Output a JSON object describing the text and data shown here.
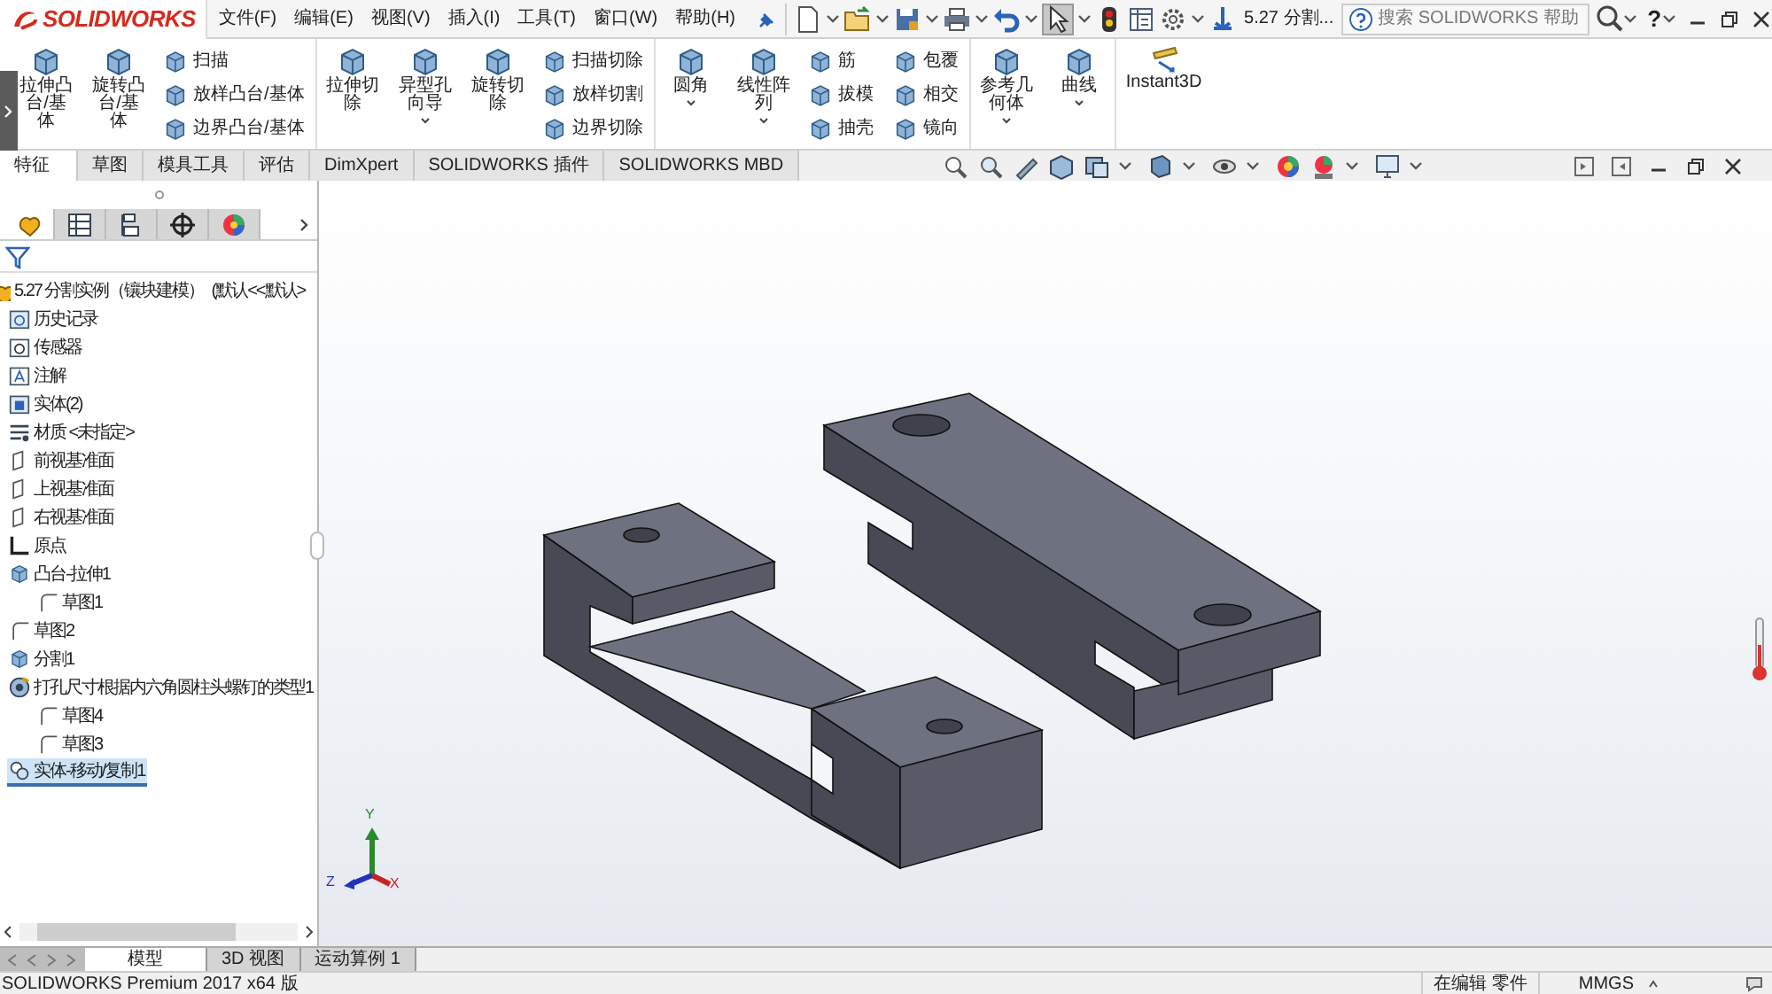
{
  "app": {
    "logo": "SOLIDWORKS",
    "document_title": "5.27 分割...",
    "help": "?"
  },
  "menu": [
    "文件(F)",
    "编辑(E)",
    "视图(V)",
    "插入(I)",
    "工具(T)",
    "窗口(W)",
    "帮助(H)"
  ],
  "search": {
    "placeholder": "搜索 SOLIDWORKS 帮助"
  },
  "ribbon": [
    {
      "columns": [
        {
          "kind": "large",
          "items": [
            {
              "label": "拉伸凸台/基体",
              "dropdown": false
            }
          ]
        },
        {
          "kind": "large",
          "items": [
            {
              "label": "旋转凸台/基体",
              "dropdown": false
            }
          ]
        },
        {
          "kind": "stack",
          "items": [
            {
              "label": "扫描"
            },
            {
              "label": "放样凸台/基体"
            },
            {
              "label": "边界凸台/基体"
            }
          ]
        }
      ]
    },
    {
      "columns": [
        {
          "kind": "large",
          "items": [
            {
              "label": "拉伸切除",
              "dropdown": false
            }
          ]
        },
        {
          "kind": "large",
          "items": [
            {
              "label": "异型孔向导",
              "dropdown": true
            }
          ]
        },
        {
          "kind": "large",
          "items": [
            {
              "label": "旋转切除",
              "dropdown": false
            }
          ]
        },
        {
          "kind": "stack",
          "items": [
            {
              "label": "扫描切除"
            },
            {
              "label": "放样切割"
            },
            {
              "label": "边界切除"
            }
          ]
        }
      ]
    },
    {
      "columns": [
        {
          "kind": "large",
          "items": [
            {
              "label": "圆角",
              "dropdown": true
            }
          ]
        },
        {
          "kind": "large",
          "items": [
            {
              "label": "线性阵列",
              "dropdown": true
            }
          ]
        },
        {
          "kind": "stack",
          "items": [
            {
              "label": "筋"
            },
            {
              "label": "拔模"
            },
            {
              "label": "抽壳"
            }
          ]
        },
        {
          "kind": "stack",
          "items": [
            {
              "label": "包覆"
            },
            {
              "label": "相交"
            },
            {
              "label": "镜向"
            }
          ]
        }
      ]
    },
    {
      "columns": [
        {
          "kind": "large",
          "items": [
            {
              "label": "参考几何体",
              "dropdown": true
            }
          ]
        },
        {
          "kind": "large",
          "items": [
            {
              "label": "曲线",
              "dropdown": true
            }
          ]
        }
      ]
    },
    {
      "columns": [
        {
          "kind": "wide",
          "items": [
            {
              "label": "Instant3D",
              "dropdown": false
            }
          ]
        }
      ]
    }
  ],
  "command_tabs": [
    {
      "label": "特征",
      "selected": true
    },
    {
      "label": "草图",
      "selected": false
    },
    {
      "label": "模具工具",
      "selected": false
    },
    {
      "label": "评估",
      "selected": false
    },
    {
      "label": "DimXpert",
      "selected": false
    },
    {
      "label": "SOLIDWORKS 插件",
      "selected": false
    },
    {
      "label": "SOLIDWORKS MBD",
      "selected": false
    }
  ],
  "panel_tabs": [
    {
      "kind": "feature-tree",
      "selected": true
    },
    {
      "kind": "property",
      "selected": false
    },
    {
      "kind": "configuration",
      "selected": false
    },
    {
      "kind": "dimxpert",
      "selected": false
    },
    {
      "kind": "display",
      "selected": false
    }
  ],
  "tree": {
    "root": {
      "label": "5.27 分割实例（镶块建模）",
      "configuration": "(默认<<默认>"
    },
    "items": [
      {
        "kind": "history",
        "label": "历史记录",
        "selected": false
      },
      {
        "kind": "sensor",
        "label": "传感器",
        "selected": false
      },
      {
        "kind": "annotation",
        "label": "注解",
        "selected": false
      },
      {
        "kind": "bodies",
        "label": "实体(2)",
        "selected": false
      },
      {
        "kind": "material",
        "label": "材质 <未指定>",
        "selected": false
      },
      {
        "kind": "plane",
        "label": "前视基准面",
        "selected": false
      },
      {
        "kind": "plane",
        "label": "上视基准面",
        "selected": false
      },
      {
        "kind": "plane",
        "label": "右视基准面",
        "selected": false
      },
      {
        "kind": "origin",
        "label": "原点",
        "selected": false
      },
      {
        "kind": "extrude",
        "label": "凸台-拉伸1",
        "selected": false,
        "children": [
          {
            "kind": "sketch",
            "label": "草图1",
            "selected": false
          }
        ]
      },
      {
        "kind": "sketch",
        "label": "草图2",
        "selected": false
      },
      {
        "kind": "split",
        "label": "分割1",
        "selected": false
      },
      {
        "kind": "hole",
        "label": "打孔尺寸根据内六角圆柱头螺钉的类型1",
        "selected": false,
        "children": [
          {
            "kind": "sketch",
            "label": "草图4",
            "selected": false
          },
          {
            "kind": "sketch",
            "label": "草图3",
            "selected": false
          }
        ]
      },
      {
        "kind": "move",
        "label": "实体-移动/复制1",
        "selected": true
      }
    ]
  },
  "triad": {
    "x": "X",
    "y": "Y",
    "z": "Z"
  },
  "bottom_tabs": [
    {
      "label": "模型",
      "selected": true
    },
    {
      "label": "3D 视图",
      "selected": false
    },
    {
      "label": "运动算例 1",
      "selected": false
    }
  ],
  "status_bar": {
    "product": "SOLIDWORKS Premium 2017 x64 版",
    "mode": "在编辑 零件",
    "units": "MMGS"
  }
}
